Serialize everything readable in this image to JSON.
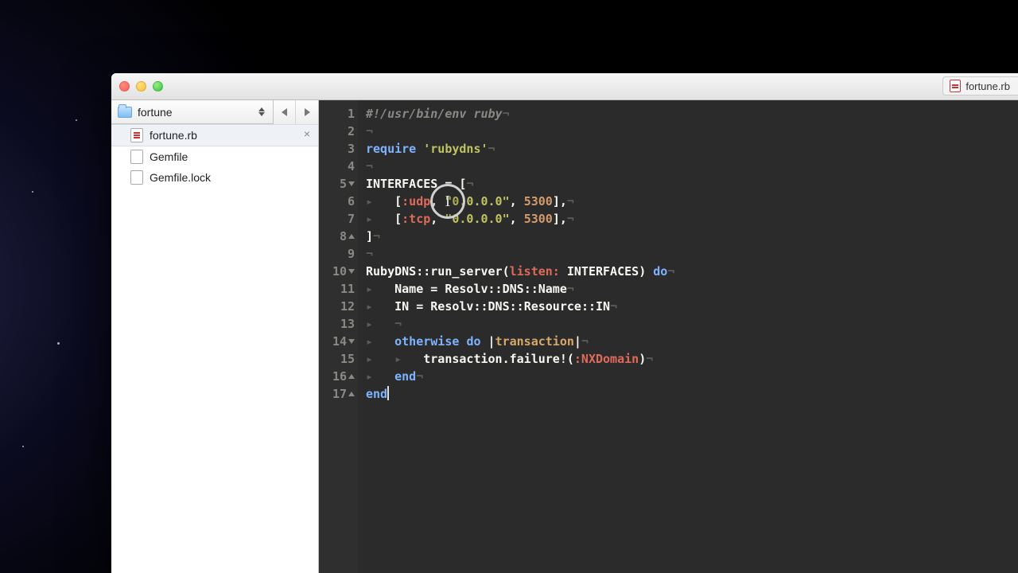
{
  "window": {
    "open_file_tab": "fortune.rb"
  },
  "sidebar": {
    "folder_name": "fortune",
    "files": [
      {
        "name": "fortune.rb",
        "type": "ruby",
        "active": true
      },
      {
        "name": "Gemfile",
        "type": "text",
        "active": false
      },
      {
        "name": "Gemfile.lock",
        "type": "text",
        "active": false
      }
    ]
  },
  "editor": {
    "gutter": [
      {
        "n": "1",
        "fold": ""
      },
      {
        "n": "2",
        "fold": ""
      },
      {
        "n": "3",
        "fold": ""
      },
      {
        "n": "4",
        "fold": ""
      },
      {
        "n": "5",
        "fold": "open"
      },
      {
        "n": "6",
        "fold": ""
      },
      {
        "n": "7",
        "fold": ""
      },
      {
        "n": "8",
        "fold": "close"
      },
      {
        "n": "9",
        "fold": ""
      },
      {
        "n": "10",
        "fold": "open"
      },
      {
        "n": "11",
        "fold": ""
      },
      {
        "n": "12",
        "fold": ""
      },
      {
        "n": "13",
        "fold": ""
      },
      {
        "n": "14",
        "fold": "open"
      },
      {
        "n": "15",
        "fold": ""
      },
      {
        "n": "16",
        "fold": "close"
      },
      {
        "n": "17",
        "fold": "close"
      }
    ],
    "code_plain": "#!/usr/bin/env ruby\n\nrequire 'rubydns'\n\nINTERFACES = [\n    [:udp, \"0.0.0.0\", 5300],\n    [:tcp, \"0.0.0.0\", 5300],\n]\n\nRubyDNS::run_server(listen: INTERFACES) do\n    Name = Resolv::DNS::Name\n    IN = Resolv::DNS::Resource::IN\n    \n    otherwise do |transaction|\n        transaction.failure!(:NXDomain)\n    end\nend",
    "tok": {
      "shebang": "#!/usr/bin/env ruby",
      "require": "require",
      "rubydns": "'rubydns'",
      "interfaces": "INTERFACES",
      "udp": ":udp",
      "tcp": ":tcp",
      "ip": "\"0.0.0.0\"",
      "port": "5300",
      "rubydnsmod": "RubyDNS",
      "run_server": "run_server",
      "listen": "listen:",
      "do": "do",
      "name": "Name",
      "resolv": "Resolv",
      "dns": "DNS",
      "nameconst": "Name",
      "in": "IN",
      "resource": "Resource",
      "inconst": "IN",
      "otherwise": "otherwise",
      "transaction": "transaction",
      "failure": "failure!",
      "nxdomain": ":NXDomain",
      "end": "end",
      "eq": " = ",
      "inv_nl": "¬",
      "inv_tab": "▸   "
    }
  }
}
